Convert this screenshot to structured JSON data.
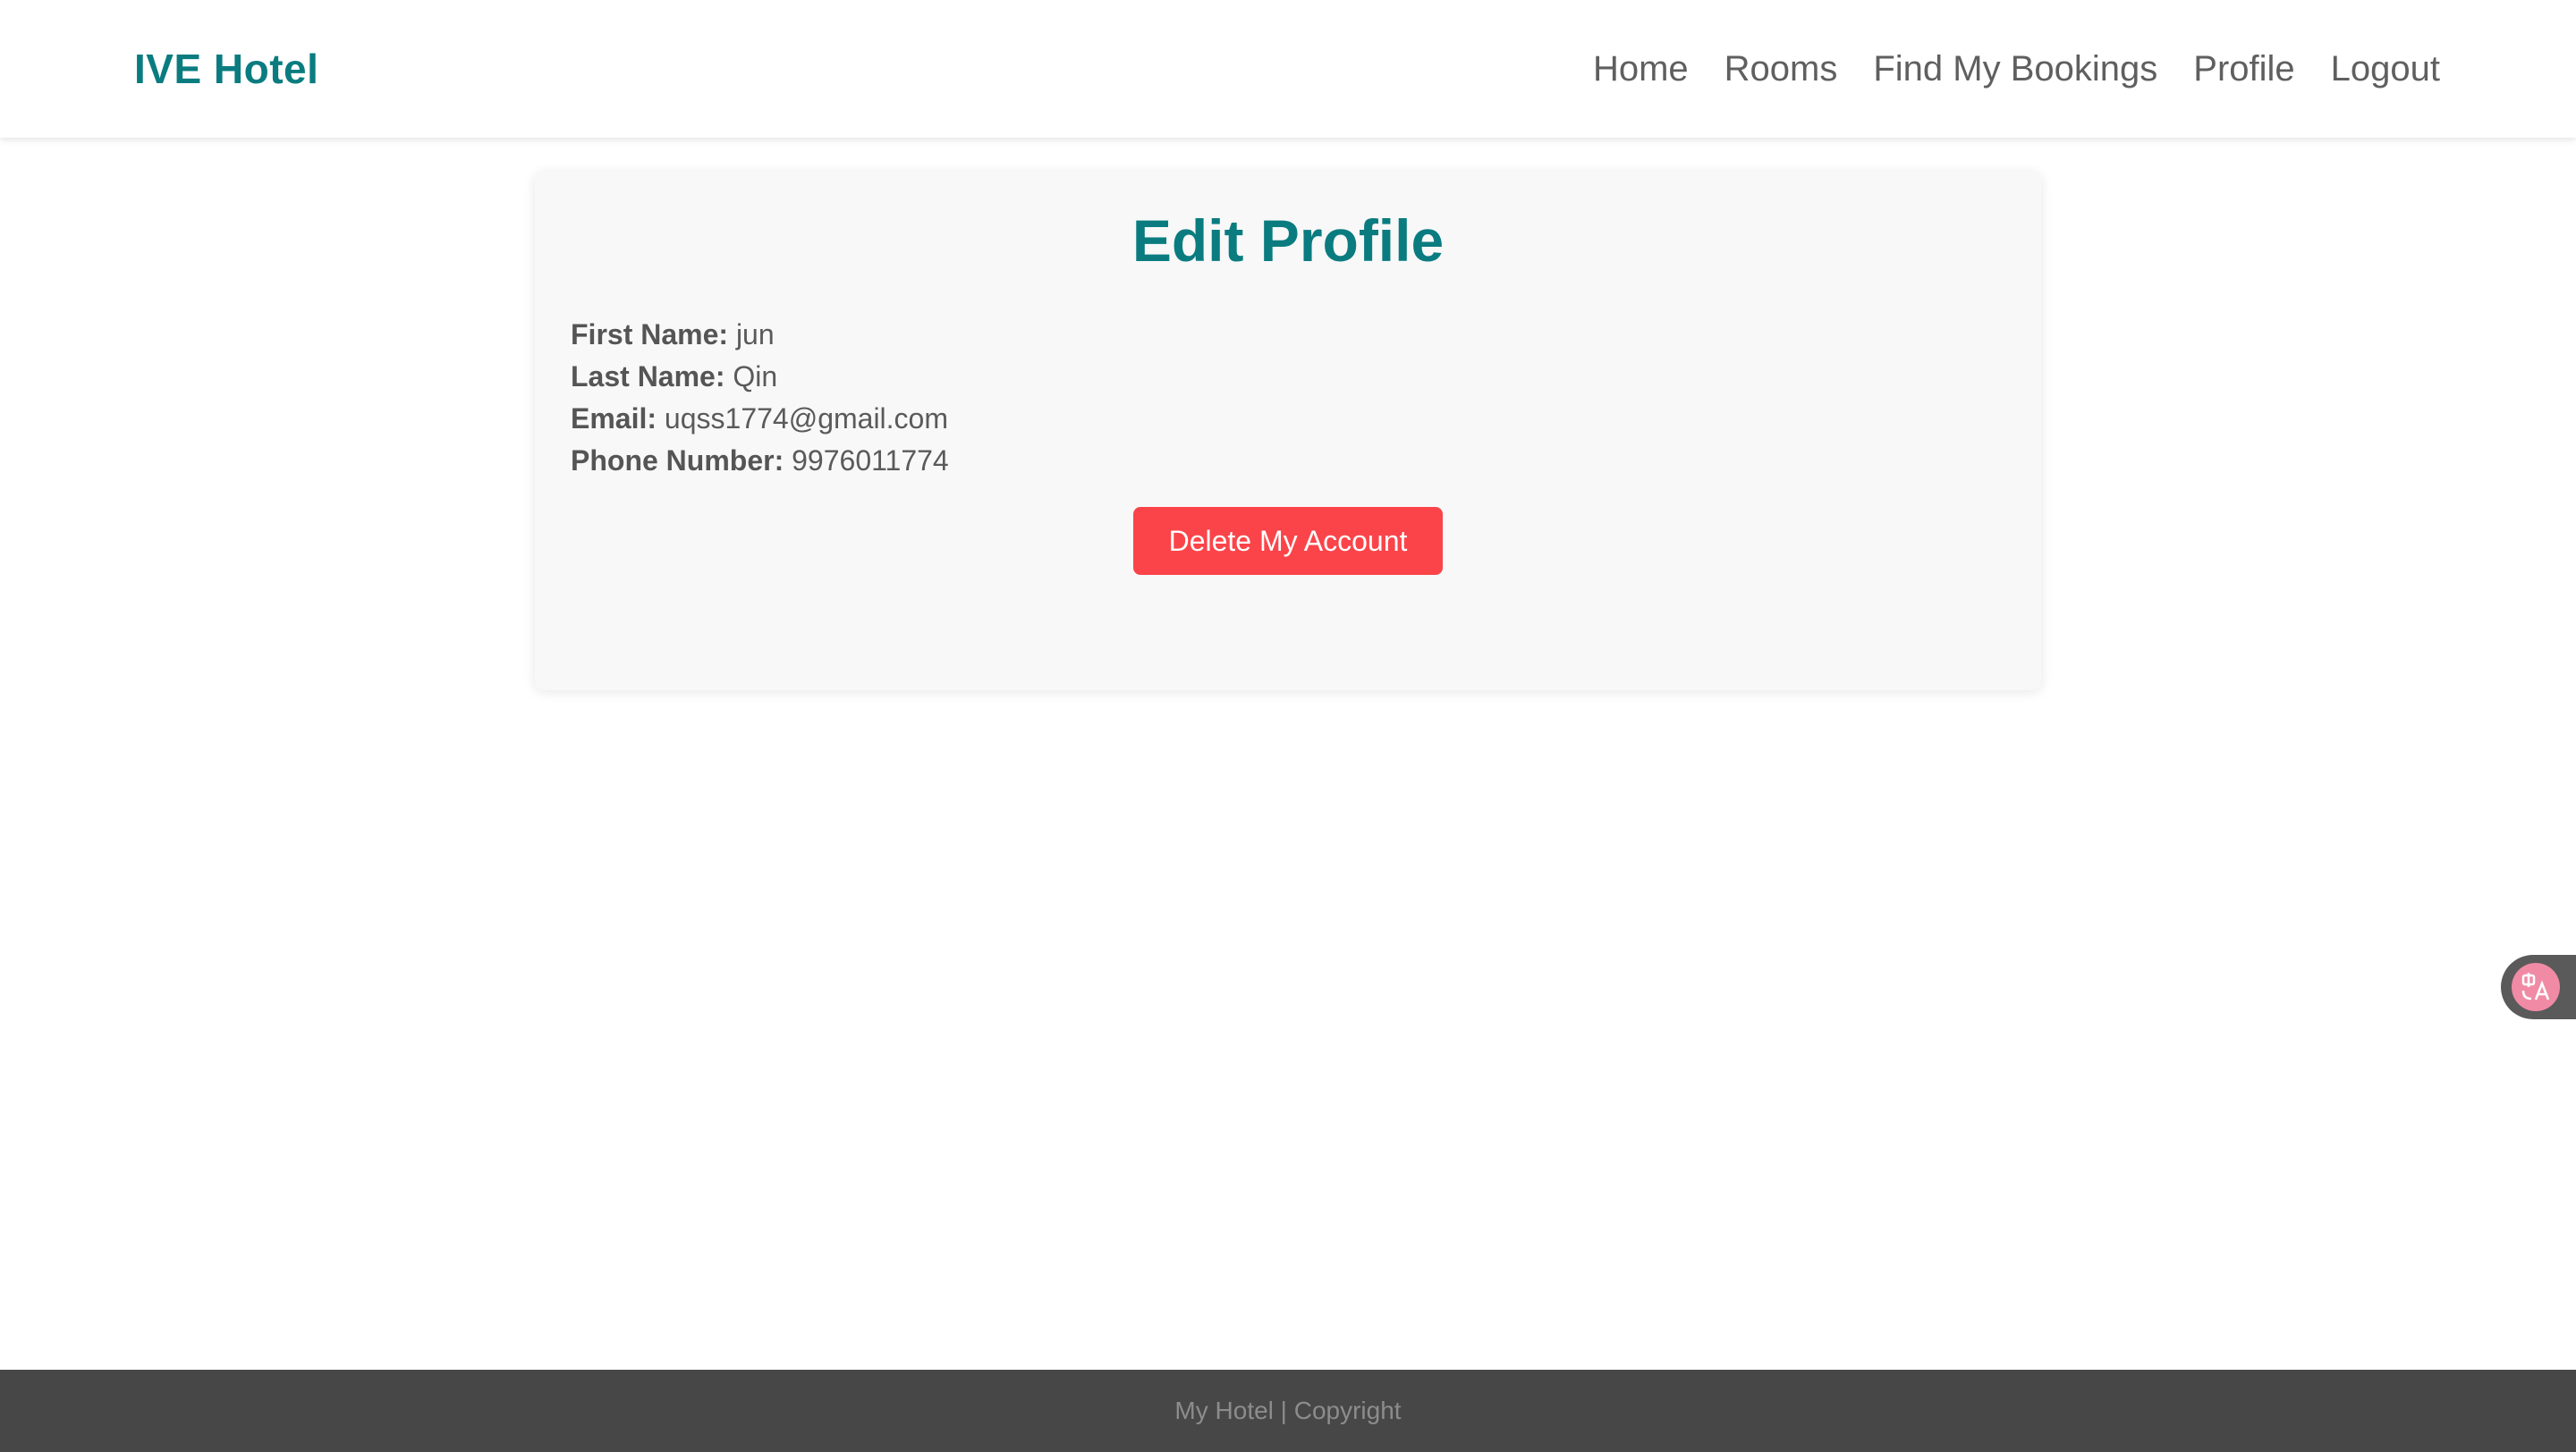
{
  "header": {
    "brand": "IVE Hotel",
    "nav": [
      {
        "label": "Home"
      },
      {
        "label": "Rooms"
      },
      {
        "label": "Find My Bookings"
      },
      {
        "label": "Profile"
      },
      {
        "label": "Logout"
      }
    ]
  },
  "profile": {
    "title": "Edit Profile",
    "fields": [
      {
        "label": "First Name:",
        "value": "jun"
      },
      {
        "label": "Last Name:",
        "value": "Qin"
      },
      {
        "label": "Email:",
        "value": "uqss1774@gmail.com"
      },
      {
        "label": "Phone Number:",
        "value": "9976011774"
      }
    ],
    "delete_button": "Delete My Account"
  },
  "widgets": {
    "translate_icon": "translate-icon"
  },
  "footer": {
    "text": "My Hotel | Copyright"
  },
  "colors": {
    "brand": "#0a7c80",
    "danger": "#fb4449",
    "footer_bg": "#474747"
  }
}
